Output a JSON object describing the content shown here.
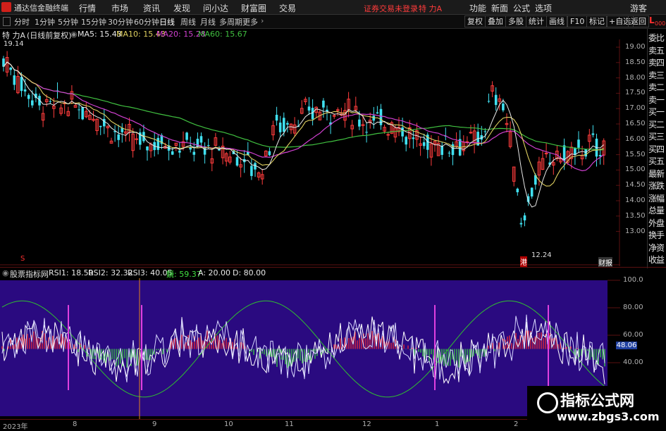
{
  "menubar": {
    "app_title": "通达信金融终端",
    "items": [
      "行情",
      "市场",
      "资讯",
      "发现",
      "问小达",
      "财富圈",
      "交易"
    ],
    "trade_warning": "证券交易未登录",
    "stock_short": "特 力A",
    "right_items": [
      "功能",
      "新面",
      "公式",
      "选项"
    ],
    "guest": "游客"
  },
  "toolbar": {
    "periods": [
      "分时",
      "1分钟",
      "5分钟",
      "15分钟",
      "30分钟",
      "60分钟",
      "日线",
      "周线",
      "月线",
      "多周期",
      "更多"
    ],
    "selected": "日线",
    "right_buttons": [
      "复权",
      "叠加",
      "多股",
      "统计",
      "画线",
      "F10",
      "标记",
      "+自选",
      "返回"
    ]
  },
  "info": {
    "stock": "特 力A",
    "mode": "(日线前复权)",
    "ma5": "MA5: 15.43",
    "ma10": "MA10: 15.43",
    "ma20": "MA20: 15.28",
    "ma60": "MA60: 15.67"
  },
  "colors": {
    "ma5": "#e8e8e8",
    "ma10": "#e0d060",
    "ma20": "#d040d0",
    "ma60": "#40c040",
    "up": "#ff3c3c",
    "down": "#40e0f0",
    "indicator_bg": "#2a0a80"
  },
  "right_panel": {
    "top_label": "L",
    "top_sub": "000",
    "items": [
      "委比",
      "卖五",
      "卖四",
      "卖三",
      "卖二",
      "卖一",
      "买一",
      "买二",
      "买三",
      "买四",
      "买五",
      "最新",
      "涨跌",
      "涨幅",
      "总量",
      "外盘",
      "换手",
      "净资",
      "收益"
    ]
  },
  "price_axis": [
    "19.00",
    "18.50",
    "18.00",
    "17.50",
    "17.00",
    "16.50",
    "16.00",
    "15.50",
    "15.00",
    "14.50",
    "14.00",
    "13.50",
    "13.00"
  ],
  "price_high_label": "19.14",
  "price_low_label": "12.24",
  "markers": {
    "left_s": "S",
    "gang": "港",
    "report": "财报"
  },
  "indicator": {
    "name": "股票指标网",
    "rsi1": "RSI1: 18.50",
    "rsi2": "RSI2: 32.32",
    "rsi3": "RSI3: 40.05",
    "jing": "鏡: 59.37",
    "a": "A: 20.00",
    "d": "D: 80.00",
    "axis": [
      "100.0",
      "80.00",
      "60.00",
      "40.00"
    ],
    "current": "48.06"
  },
  "x_axis": [
    "2023年",
    "8",
    "9",
    "10",
    "11",
    "12",
    "1",
    "2"
  ],
  "watermark": {
    "line1": "指标公式网",
    "line2": "www.zbgs3.com"
  }
}
